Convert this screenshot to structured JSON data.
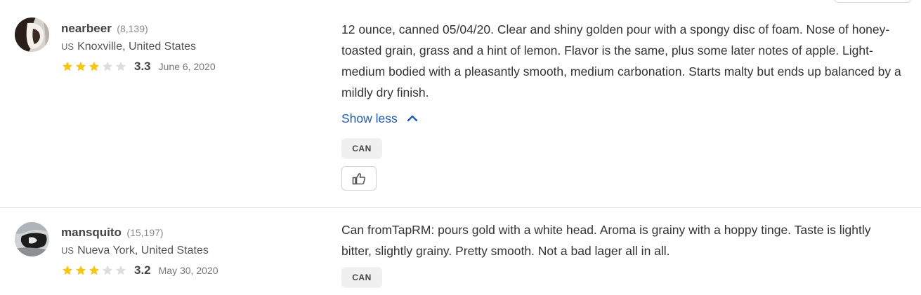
{
  "reviews": [
    {
      "username": "nearbeer",
      "review_count": "(8,139)",
      "country_code": "US",
      "location": "Knoxville, United States",
      "stars_filled": 3,
      "stars_total": 5,
      "score": "3.3",
      "date": "June 6, 2020",
      "text": "12 ounce, canned 05/04/20. Clear and shiny golden pour with a spongy disc of foam. Nose of honey-toasted grain, grass and a hint of lemon. Flavor is the same, plus some later notes of apple. Light-medium bodied with a pleasantly smooth, medium carbonation. Starts malty but ends up balanced by a mildly dry finish.",
      "show_less_label": "Show less",
      "tag": "CAN",
      "like_icon": "thumbs-up-icon"
    },
    {
      "username": "mansquito",
      "review_count": "(15,197)",
      "country_code": "US",
      "location": "Nueva York, United States",
      "stars_filled": 3,
      "stars_total": 5,
      "score": "3.2",
      "date": "May 30, 2020",
      "text": "Can fromTapRM: pours gold with a white head. Aroma is grainy with a hoppy tinge. Taste is lightly bitter, slightly grainy. Pretty smooth. Not a bad lager all in all.",
      "tag": "CAN"
    }
  ],
  "colors": {
    "star_filled": "#F5C518",
    "star_empty": "#DDDDDD",
    "link": "#1F5CB0",
    "divider": "#DCDCDC"
  }
}
